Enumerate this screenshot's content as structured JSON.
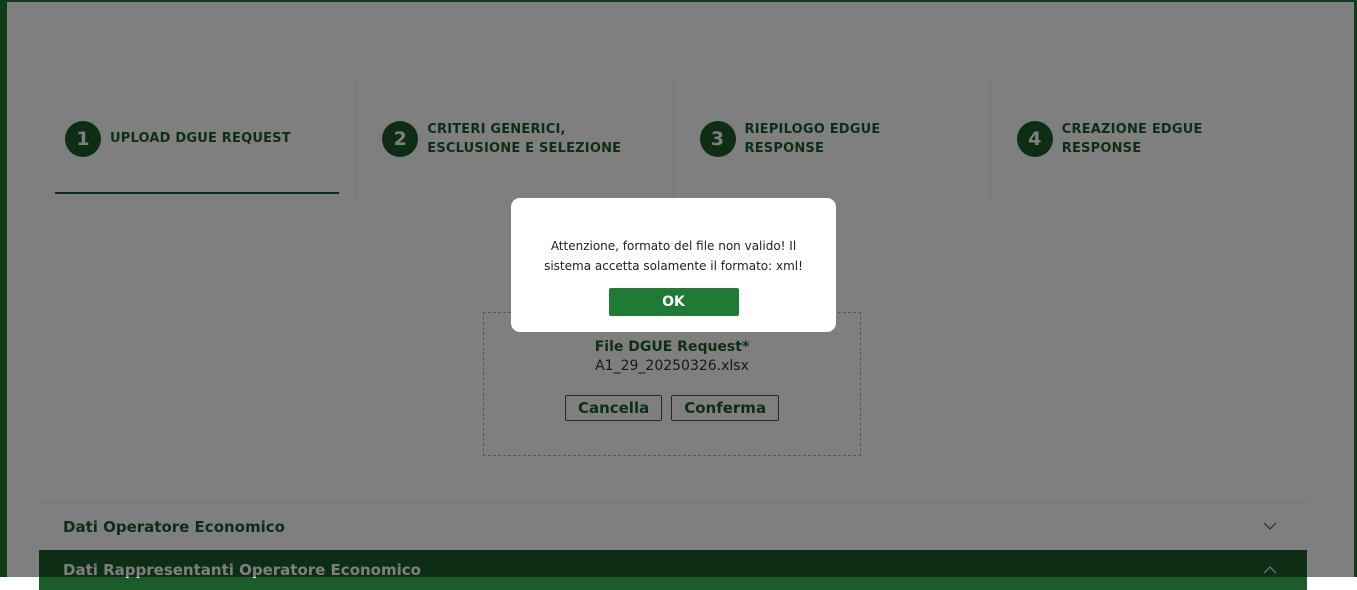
{
  "stepper": {
    "steps": [
      {
        "number": "1",
        "label": "UPLOAD DGUE REQUEST"
      },
      {
        "number": "2",
        "label": "CRITERI GENERICI, ESCLUSIONE E SELEZIONE"
      },
      {
        "number": "3",
        "label": "RIEPILOGO EDGUE RESPONSE"
      },
      {
        "number": "4",
        "label": "CREAZIONE EDGUE RESPONSE"
      }
    ],
    "active_step": 1
  },
  "upload": {
    "title": "File DGUE Request*",
    "file_name": "A1_29_20250326.xlsx",
    "cancel_label": "Cancella",
    "confirm_label": "Conferma"
  },
  "sections": [
    {
      "title": "Dati Operatore Economico",
      "icon": "chevron-down-icon"
    },
    {
      "title": "Dati Rappresentanti Operatore Economico",
      "icon": "chevron-up-icon"
    }
  ],
  "modal": {
    "message": "Attenzione, formato del file non valido! Il sistema accetta solamente il formato: xml!",
    "ok_label": "OK"
  },
  "colors": {
    "brand_green": "#1a5c2a",
    "button_green": "#1f7a33",
    "frame_border": "#1b7a2f"
  }
}
